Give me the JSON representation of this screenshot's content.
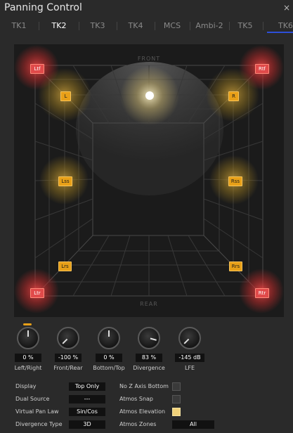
{
  "window": {
    "title": "Panning Control",
    "close_glyph": "×"
  },
  "tabs": [
    {
      "label": "TK1",
      "active": false
    },
    {
      "label": "TK2",
      "active": true
    },
    {
      "label": "TK3",
      "active": false
    },
    {
      "label": "TK4",
      "active": false
    },
    {
      "label": "MCS",
      "active": false
    },
    {
      "label": "Ambi-2",
      "active": false
    },
    {
      "label": "TK5",
      "active": false
    },
    {
      "label": "TK6",
      "active": false
    }
  ],
  "pan_area": {
    "front_label": "FRONT",
    "rear_label": "REAR",
    "speakers": {
      "ltf": "Ltf",
      "rtf": "Rtf",
      "l": "L",
      "r": "R",
      "lss": "Lss",
      "rss": "Rss",
      "lrs": "Lrs",
      "rrs": "Rrs",
      "ltr": "Ltr",
      "rtr": "Rtr"
    },
    "colors": {
      "height_speaker": "#e04a4a",
      "bed_speaker": "#e8a018",
      "source": "#ffffff"
    }
  },
  "knobs": [
    {
      "name": "left-right",
      "label": "Left/Right",
      "value": "0 %"
    },
    {
      "name": "front-rear",
      "label": "Front/Rear",
      "value": "-100 %"
    },
    {
      "name": "bottom-top",
      "label": "Bottom/Top",
      "value": "0 %"
    },
    {
      "name": "divergence",
      "label": "Divergence",
      "value": "83 %"
    },
    {
      "name": "lfe",
      "label": "LFE",
      "value": "-145 dB"
    }
  ],
  "options": {
    "display": {
      "label": "Display",
      "value": "Top Only"
    },
    "dual_source": {
      "label": "Dual Source",
      "value": "---"
    },
    "virtual_pan_law": {
      "label": "Virtual Pan Law",
      "value": "Sin/Cos"
    },
    "divergence_type": {
      "label": "Divergence Type",
      "value": "3D"
    },
    "no_z_axis_bottom": {
      "label": "No Z Axis Bottom",
      "checked": false
    },
    "atmos_snap": {
      "label": "Atmos Snap",
      "checked": false
    },
    "atmos_elevation": {
      "label": "Atmos Elevation",
      "checked": true
    },
    "atmos_zones": {
      "label": "Atmos Zones",
      "value": "All"
    }
  }
}
